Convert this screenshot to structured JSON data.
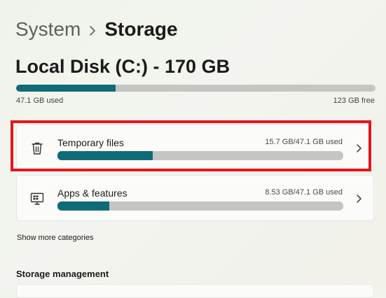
{
  "breadcrumb": {
    "parent": "System",
    "current": "Storage"
  },
  "disk": {
    "title": "Local Disk (C:) - 170 GB",
    "used_label": "47.1 GB used",
    "free_label": "123 GB free",
    "used_fraction": 0.277
  },
  "categories": [
    {
      "title": "Temporary files",
      "usage": "15.7 GB/47.1 GB used",
      "fraction": 0.333,
      "icon": "trash-icon",
      "highlighted": true
    },
    {
      "title": "Apps & features",
      "usage": "8.53 GB/47.1 GB used",
      "fraction": 0.181,
      "icon": "apps-icon",
      "highlighted": false
    }
  ],
  "show_more": "Show more categories",
  "storage_management": {
    "heading": "Storage management"
  },
  "colors": {
    "accent": "#0f6b76",
    "track": "#c5c5c2",
    "highlight": "#e8141c"
  }
}
